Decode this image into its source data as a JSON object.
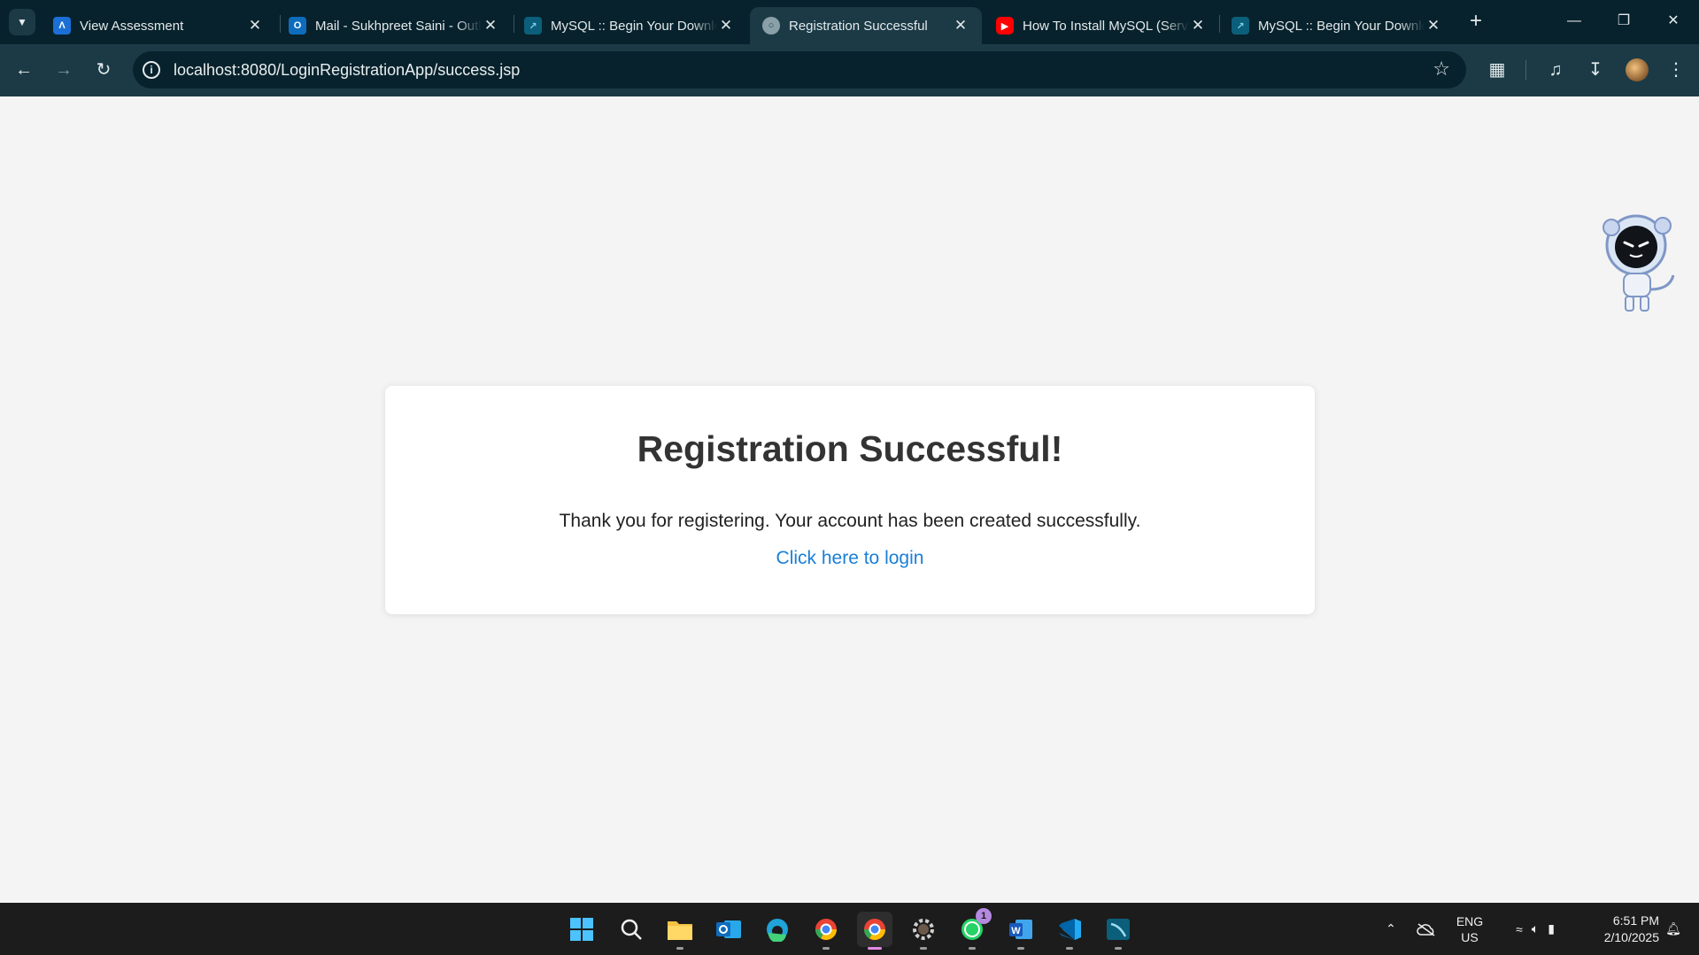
{
  "browser": {
    "tabs": [
      {
        "title": "View Assessment",
        "favicon": "a-logo-icon",
        "active": false
      },
      {
        "title": "Mail - Sukhpreet Saini - Outlook",
        "favicon": "outlook-icon",
        "active": false
      },
      {
        "title": "MySQL :: Begin Your Download",
        "favicon": "mysql-icon",
        "active": false
      },
      {
        "title": "Registration Successful",
        "favicon": "globe-icon",
        "active": true
      },
      {
        "title": "How To Install MySQL (Server",
        "favicon": "youtube-icon",
        "active": false
      },
      {
        "title": "MySQL :: Begin Your Download",
        "favicon": "mysql-icon",
        "active": false
      }
    ],
    "url": "localhost:8080/LoginRegistrationApp/success.jsp"
  },
  "page": {
    "heading": "Registration Successful!",
    "message": "Thank you for registering. Your account has been created successfully.",
    "login_link": "Click here to login"
  },
  "taskbar": {
    "whatsapp_badge": "1",
    "lang_top": "ENG",
    "lang_bottom": "US",
    "time": "6:51 PM",
    "date": "2/10/2025"
  },
  "colors": {
    "tabstrip": "#07222c",
    "toolbar": "#1b3a46",
    "page_bg": "#f4f4f4",
    "link": "#1a7fd6",
    "taskbar": "#1c1c1c"
  }
}
